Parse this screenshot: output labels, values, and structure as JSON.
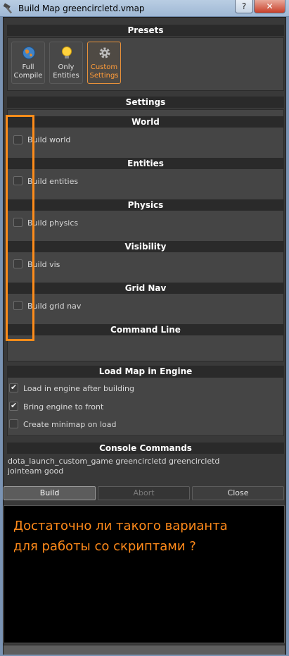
{
  "window": {
    "title": "Build Map greencircletd.vmap",
    "help_label": "?",
    "close_label": "✕"
  },
  "presets": {
    "header": "Presets",
    "buttons": [
      {
        "line1": "Full",
        "line2": "Compile",
        "icon": "globe-icon",
        "active": false
      },
      {
        "line1": "Only",
        "line2": "Entities",
        "icon": "lightbulb-icon",
        "active": false
      },
      {
        "line1": "Custom",
        "line2": "Settings",
        "icon": "gear-icon",
        "active": true
      }
    ]
  },
  "settings": {
    "header": "Settings",
    "groups": [
      {
        "header": "World",
        "option": "Build world",
        "checked": false
      },
      {
        "header": "Entities",
        "option": "Build entities",
        "checked": false
      },
      {
        "header": "Physics",
        "option": "Build physics",
        "checked": false
      },
      {
        "header": "Visibility",
        "option": "Build vis",
        "checked": false
      },
      {
        "header": "Grid Nav",
        "option": "Build grid nav",
        "checked": false
      }
    ],
    "command_line_header": "Command Line"
  },
  "load_map": {
    "header": "Load Map in Engine",
    "options": [
      {
        "label": "Load in engine after building",
        "checked": true
      },
      {
        "label": "Bring engine to front",
        "checked": true
      },
      {
        "label": "Create minimap on load",
        "checked": false
      }
    ]
  },
  "console_commands": {
    "header": "Console Commands",
    "line1": "dota_launch_custom_game greencircletd greencircletd",
    "line2": "jointeam good"
  },
  "actions": {
    "build": "Build",
    "abort": "Abort",
    "close": "Close"
  },
  "output": {
    "line1": "Достаточно ли такого варианта",
    "line2": "для работы со скриптами ?"
  },
  "colors": {
    "accent": "#ff8c1a",
    "background": "#393939",
    "header": "#2a2a2a"
  }
}
